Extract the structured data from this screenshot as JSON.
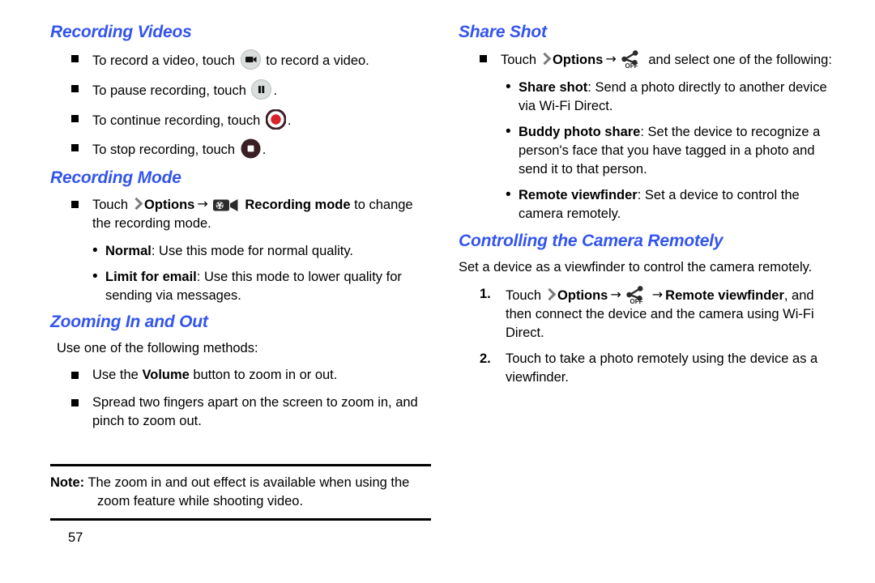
{
  "page": {
    "number": "57",
    "accent_color": "#3355ee",
    "text_color": "#000000",
    "background": "#ffffff"
  },
  "left_column": {
    "recording_videos": {
      "heading": "Recording Videos",
      "bullets": [
        {
          "before": "To record a video, touch ",
          "icon": "camcorder-record-icon",
          "after": " to record a video."
        },
        {
          "before": "To pause recording, touch ",
          "icon": "pause-icon",
          "after": "."
        },
        {
          "before": "To continue recording, touch ",
          "icon": "record-dot-icon",
          "after": "."
        },
        {
          "before": "To stop recording, touch ",
          "icon": "stop-square-icon",
          "after": "."
        }
      ]
    },
    "recording_mode": {
      "heading": "Recording Mode",
      "bullet": {
        "touch_label": "Touch",
        "options_label": "Options",
        "icon": "recording-mode-icon",
        "bold_label": "Recording mode",
        "tail": " to change the recording mode."
      },
      "sub_bullets": [
        {
          "term": "Normal",
          "desc": ": Use this mode for normal quality."
        },
        {
          "term": "Limit for email",
          "desc": ": Use this mode to lower quality for sending via messages."
        }
      ]
    },
    "zooming": {
      "heading": "Zooming In and Out",
      "intro": "Use one of the following methods:",
      "bullets": [
        {
          "before": "Use the ",
          "bold": "Volume",
          "after": " button to zoom in or out."
        },
        {
          "before": "Spread two fingers apart on the screen to zoom in, and pinch to zoom out.",
          "bold": "",
          "after": ""
        }
      ]
    },
    "note": {
      "label": "Note:",
      "text": " The zoom in and out effect is available when using the zoom feature while shooting video."
    }
  },
  "right_column": {
    "share_shot": {
      "heading": "Share Shot",
      "bullet": {
        "touch_label": "Touch",
        "options_label": "Options",
        "icon": "share-shot-off-icon",
        "tail": " and select one of the following:"
      },
      "sub_bullets": [
        {
          "term": "Share shot",
          "desc": ": Send a photo directly to another device via Wi-Fi Direct."
        },
        {
          "term": "Buddy photo share",
          "desc": ": Set the device to recognize a person's face that you have tagged in a photo and send it to that person."
        },
        {
          "term": "Remote viewfinder",
          "desc": ": Set a device to control the camera remotely."
        }
      ]
    },
    "controlling_camera": {
      "heading": "Controlling the Camera Remotely",
      "intro": "Set a device as a viewfinder to control the camera remotely.",
      "steps": [
        {
          "number": "1.",
          "touch_label": "Touch",
          "options_label": "Options",
          "icon": "share-shot-off-icon",
          "bold_label": "Remote viewfinder",
          "tail": ", and then connect the device and the camera using Wi-Fi Direct."
        },
        {
          "number": "2.",
          "text": "Touch to take a photo remotely using the device as a viewfinder."
        }
      ]
    }
  },
  "icons": {
    "camcorder_record": "camcorder-record-icon",
    "pause": "pause-icon",
    "record_dot": "record-dot-icon",
    "stop_square": "stop-square-icon",
    "recording_mode": "recording-mode-icon",
    "share_shot_off": "share-shot-off-icon",
    "chevron_right": "chevron-right-icon",
    "arrow_right": "arrow-right-icon",
    "arrow_right_glyph": "→"
  }
}
